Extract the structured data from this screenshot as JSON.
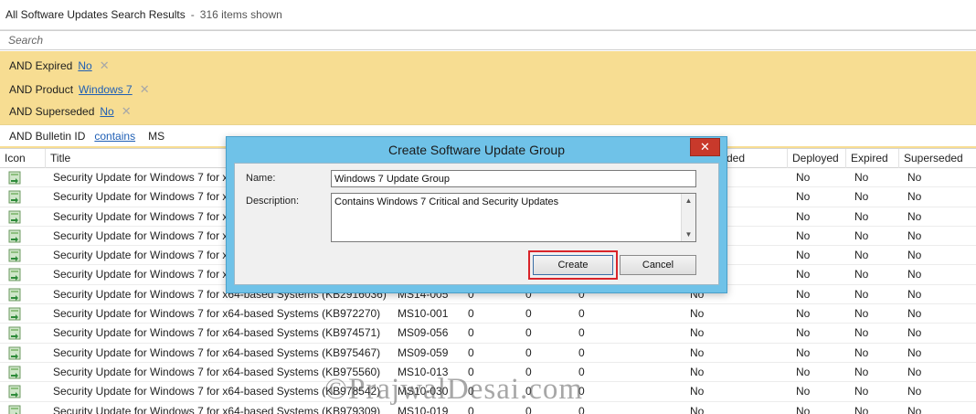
{
  "header": {
    "title": "All Software Updates Search Results",
    "separator": "-",
    "count_text": "316 items shown"
  },
  "search": {
    "placeholder": "Search"
  },
  "criteria": [
    {
      "label": "AND Expired",
      "value": "No",
      "remove": "✕"
    },
    {
      "label": "AND Product",
      "value": "Windows 7",
      "remove": "✕"
    },
    {
      "label": "AND Superseded",
      "value": "No",
      "remove": "✕"
    },
    {
      "label": "AND Bulletin ID",
      "operator": "contains",
      "text": "MS"
    }
  ],
  "table": {
    "columns": [
      "Icon",
      "Title",
      "ded",
      "Deployed",
      "Expired",
      "Superseded"
    ],
    "rows": [
      {
        "title": "Security Update for Windows 7 for x6",
        "bulletin": "",
        "c1": "",
        "c2": "",
        "c3": "",
        "downloaded": "",
        "deployed": "No",
        "expired": "No",
        "superseded": "No"
      },
      {
        "title": "Security Update for Windows 7 for x6",
        "bulletin": "",
        "c1": "",
        "c2": "",
        "c3": "",
        "downloaded": "",
        "deployed": "No",
        "expired": "No",
        "superseded": "No"
      },
      {
        "title": "Security Update for Windows 7 for x6",
        "bulletin": "",
        "c1": "",
        "c2": "",
        "c3": "",
        "downloaded": "",
        "deployed": "No",
        "expired": "No",
        "superseded": "No"
      },
      {
        "title": "Security Update for Windows 7 for x6",
        "bulletin": "",
        "c1": "",
        "c2": "",
        "c3": "",
        "downloaded": "",
        "deployed": "No",
        "expired": "No",
        "superseded": "No"
      },
      {
        "title": "Security Update for Windows 7 for x6",
        "bulletin": "",
        "c1": "",
        "c2": "",
        "c3": "",
        "downloaded": "",
        "deployed": "No",
        "expired": "No",
        "superseded": "No"
      },
      {
        "title": "Security Update for Windows 7 for x6",
        "bulletin": "",
        "c1": "",
        "c2": "",
        "c3": "",
        "downloaded": "",
        "deployed": "No",
        "expired": "No",
        "superseded": "No"
      },
      {
        "title": "Security Update for Windows 7 for x64-based Systems (KB2916036)",
        "bulletin": "MS14-005",
        "c1": "0",
        "c2": "0",
        "c3": "0",
        "downloaded": "No",
        "deployed": "No",
        "expired": "No",
        "superseded": "No"
      },
      {
        "title": "Security Update for Windows 7 for x64-based Systems (KB972270)",
        "bulletin": "MS10-001",
        "c1": "0",
        "c2": "0",
        "c3": "0",
        "downloaded": "No",
        "deployed": "No",
        "expired": "No",
        "superseded": "No"
      },
      {
        "title": "Security Update for Windows 7 for x64-based Systems (KB974571)",
        "bulletin": "MS09-056",
        "c1": "0",
        "c2": "0",
        "c3": "0",
        "downloaded": "No",
        "deployed": "No",
        "expired": "No",
        "superseded": "No"
      },
      {
        "title": "Security Update for Windows 7 for x64-based Systems (KB975467)",
        "bulletin": "MS09-059",
        "c1": "0",
        "c2": "0",
        "c3": "0",
        "downloaded": "No",
        "deployed": "No",
        "expired": "No",
        "superseded": "No"
      },
      {
        "title": "Security Update for Windows 7 for x64-based Systems (KB975560)",
        "bulletin": "MS10-013",
        "c1": "0",
        "c2": "0",
        "c3": "0",
        "downloaded": "No",
        "deployed": "No",
        "expired": "No",
        "superseded": "No"
      },
      {
        "title": "Security Update for Windows 7 for x64-based Systems (KB978542)",
        "bulletin": "MS10-030",
        "c1": "0",
        "c2": "0",
        "c3": "0",
        "downloaded": "No",
        "deployed": "No",
        "expired": "No",
        "superseded": "No"
      },
      {
        "title": "Security Update for Windows 7 for x64-based Systems (KB979309)",
        "bulletin": "MS10-019",
        "c1": "0",
        "c2": "0",
        "c3": "0",
        "downloaded": "No",
        "deployed": "No",
        "expired": "No",
        "superseded": "No"
      }
    ]
  },
  "dialog": {
    "title": "Create Software Update Group",
    "close_glyph": "✕",
    "name_label": "Name:",
    "name_value": "Windows 7 Update Group",
    "description_label": "Description:",
    "description_value": "Contains Windows 7 Critical and Security Updates",
    "scroll_up_glyph": "▲",
    "scroll_down_glyph": "▼",
    "create_label": "Create",
    "cancel_label": "Cancel"
  },
  "watermark": "©PrajwalDesai.com",
  "icons": {
    "row_icon": "software-update-icon",
    "close": "close-icon"
  },
  "colors": {
    "criteria_bg": "#f7dd92",
    "dialog_frame": "#6fc2e8",
    "close_btn": "#c8392b",
    "highlight": "#d9242a",
    "link": "#1f5fb5"
  }
}
